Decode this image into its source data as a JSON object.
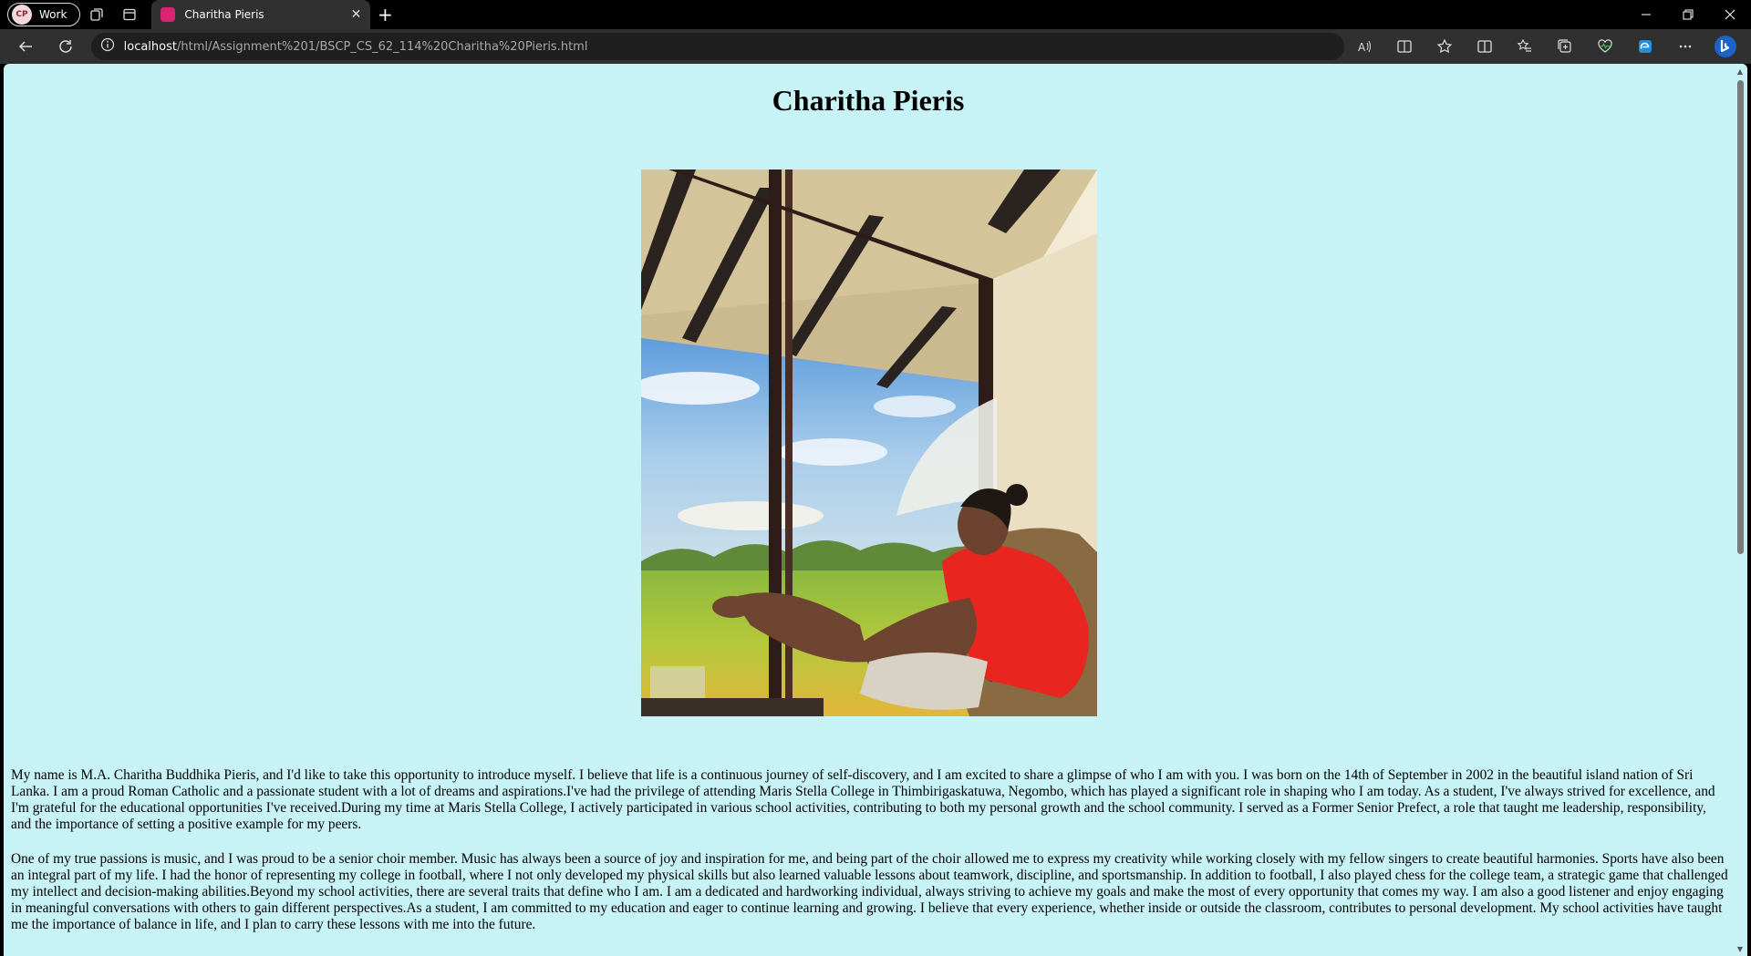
{
  "browser": {
    "profile_initials": "CP",
    "profile_name": "Work",
    "tab_title": "Charitha Pieris",
    "url_host": "localhost",
    "url_path": "/html/Assignment%201/BSCP_CS_62_114%20Charitha%20Pieris.html"
  },
  "page": {
    "title": "Charitha Pieris",
    "paragraph1": "My name is M.A. Charitha Buddhika Pieris, and I'd like to take this opportunity to introduce myself. I believe that life is a continuous journey of self-discovery, and I am excited to share a glimpse of who I am with you. I was born on the 14th of September in 2002 in the beautiful island nation of Sri Lanka. I am a proud Roman Catholic and a passionate student with a lot of dreams and aspirations.I've had the privilege of attending Maris Stella College in Thimbirigaskatuwa, Negombo, which has played a significant role in shaping who I am today. As a student, I've always strived for excellence, and I'm grateful for the educational opportunities I've received.During my time at Maris Stella College, I actively participated in various school activities, contributing to both my personal growth and the school community. I served as a Former Senior Prefect, a role that taught me leadership, responsibility, and the importance of setting a positive example for my peers.",
    "paragraph2": "One of my true passions is music, and I was proud to be a senior choir member. Music has always been a source of joy and inspiration for me, and being part of the choir allowed me to express my creativity while working closely with my fellow singers to create beautiful harmonies. Sports have also been an integral part of my life. I had the honor of representing my college in football, where I not only developed my physical skills but also learned valuable lessons about teamwork, discipline, and sportsmanship. In addition to football, I also played chess for the college team, a strategic game that challenged my intellect and decision-making abilities.Beyond my school activities, there are several traits that define who I am. I am a dedicated and hardworking individual, always striving to achieve my goals and make the most of every opportunity that comes my way. I am also a good listener and enjoy engaging in meaningful conversations with others to gain different perspectives.As a student, I am committed to my education and eager to continue learning and growing. I believe that every experience, whether inside or outside the classroom, contributes to personal development. My school activities have taught me the importance of balance in life, and I plan to carry these lessons with me into the future."
  },
  "icons": [
    "workspaces-icon",
    "tab-actions-icon",
    "back-icon",
    "refresh-icon",
    "site-info-icon",
    "read-aloud-icon",
    "immersive-reader-icon",
    "favorite-star-icon",
    "split-screen-icon",
    "favorites-icon",
    "collections-icon",
    "browser-essentials-icon",
    "edge-extension-icon",
    "more-icon",
    "copilot-icon"
  ],
  "colors": {
    "page_background": "#c7f3f6",
    "tab_favicon": "#d9256f",
    "shirt": "#e8251f"
  }
}
